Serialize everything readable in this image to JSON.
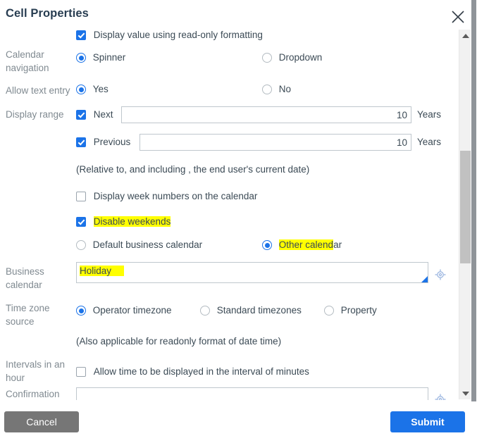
{
  "dialog": {
    "title": "Cell Properties",
    "close_icon": "close-icon"
  },
  "form": {
    "readonly_format": {
      "label": "Display value using read-only formatting",
      "checked": true
    },
    "calendar_navigation": {
      "label": "Calendar navigation",
      "options": [
        "Spinner",
        "Dropdown"
      ],
      "selected": "Spinner"
    },
    "allow_text_entry": {
      "label": "Allow text entry",
      "options": [
        "Yes",
        "No"
      ],
      "selected": "Yes"
    },
    "display_range": {
      "label": "Display range",
      "next": {
        "label": "Next",
        "checked": true,
        "value": "10",
        "unit": "Years"
      },
      "previous": {
        "label": "Previous",
        "checked": true,
        "value": "10",
        "unit": "Years"
      },
      "note": "(Relative to, and including , the end user's current date)"
    },
    "week_numbers": {
      "label": "Display week numbers on the calendar",
      "checked": false
    },
    "disable_weekends": {
      "label": "Disable weekends",
      "checked": true,
      "highlighted": true
    },
    "calendar_kind": {
      "options": [
        "Default business calendar",
        "Other calendar"
      ],
      "selected": "Other calendar",
      "highlight_prefix": "Other calend",
      "highlight_suffix": "ar"
    },
    "business_calendar": {
      "label": "Business calendar",
      "value": "Holiday",
      "reference_icon": "target-reference-icon"
    },
    "time_zone_source": {
      "label": "Time zone source",
      "options": [
        "Operator timezone",
        "Standard timezones",
        "Property"
      ],
      "selected": "Operator timezone",
      "note": "(Also applicable for readonly format of date time)"
    },
    "intervals_in_hour": {
      "label": "Intervals in an hour",
      "checkbox_label": "Allow time to be displayed in the interval of minutes",
      "checked": false
    },
    "confirmation": {
      "label": "Confirmation",
      "value": "",
      "reference_icon": "target-reference-icon"
    }
  },
  "scrollbar": {
    "up_icon": "scroll-up-arrow-icon",
    "down_icon": "scroll-down-arrow-icon"
  },
  "footer": {
    "cancel_label": "Cancel",
    "submit_label": "Submit"
  },
  "colors": {
    "accent": "#1b73e8",
    "highlight": "#ffff00",
    "label": "#808a91",
    "cancel": "#767676"
  }
}
